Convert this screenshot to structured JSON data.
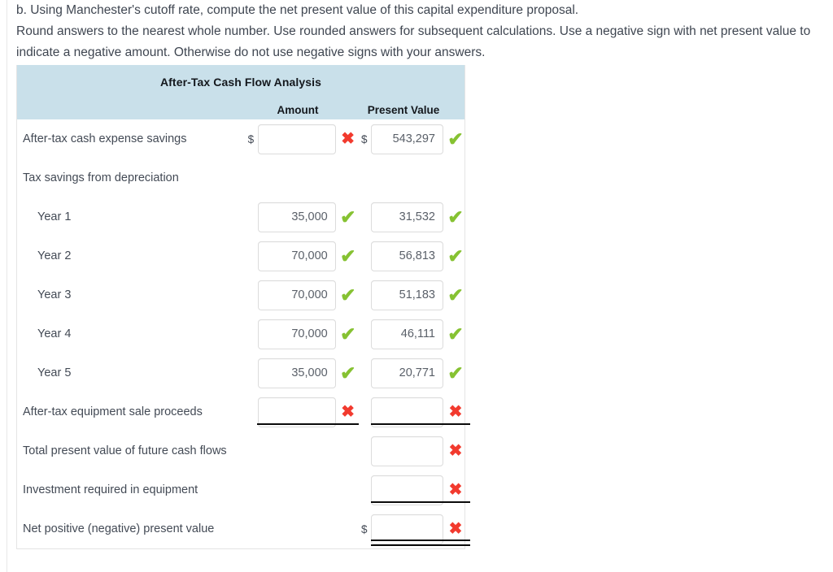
{
  "prompt": {
    "line1": "b. Using Manchester's cutoff rate, compute the net present value of this capital expenditure proposal.",
    "line2": "Round answers to the nearest whole number. Use rounded answers for subsequent calculations. Use a negative sign with net present value to indicate a negative amount. Otherwise do not use negative signs with your answers."
  },
  "table": {
    "title": "After-Tax Cash Flow Analysis",
    "columns": {
      "label": "",
      "amount": "Amount",
      "present_value": "Present Value"
    },
    "currency_symbol": "$",
    "icons": {
      "correct": "check-icon",
      "incorrect": "cross-icon"
    },
    "colors": {
      "header_background": "#c9e0ea",
      "correct": "#86c232",
      "incorrect": "#f23a2e",
      "text": "#434a55",
      "card_border": "#e4e4e4"
    },
    "rows": [
      {
        "label": "After-tax cash expense savings",
        "indent": false,
        "amount": {
          "show": true,
          "dollar": true,
          "value": "",
          "status": "incorrect"
        },
        "present_value": {
          "show": true,
          "dollar": true,
          "value": "543,297",
          "status": "correct"
        },
        "underline": "none"
      },
      {
        "label": "Tax savings from depreciation",
        "indent": false,
        "amount": {
          "show": false,
          "dollar": false,
          "value": "",
          "status": "none"
        },
        "present_value": {
          "show": false,
          "dollar": false,
          "value": "",
          "status": "none"
        },
        "underline": "none"
      },
      {
        "label": "Year 1",
        "indent": true,
        "amount": {
          "show": true,
          "dollar": false,
          "value": "35,000",
          "status": "correct"
        },
        "present_value": {
          "show": true,
          "dollar": false,
          "value": "31,532",
          "status": "correct"
        },
        "underline": "none"
      },
      {
        "label": "Year 2",
        "indent": true,
        "amount": {
          "show": true,
          "dollar": false,
          "value": "70,000",
          "status": "correct"
        },
        "present_value": {
          "show": true,
          "dollar": false,
          "value": "56,813",
          "status": "correct"
        },
        "underline": "none"
      },
      {
        "label": "Year 3",
        "indent": true,
        "amount": {
          "show": true,
          "dollar": false,
          "value": "70,000",
          "status": "correct"
        },
        "present_value": {
          "show": true,
          "dollar": false,
          "value": "51,183",
          "status": "correct"
        },
        "underline": "none"
      },
      {
        "label": "Year 4",
        "indent": true,
        "amount": {
          "show": true,
          "dollar": false,
          "value": "70,000",
          "status": "correct"
        },
        "present_value": {
          "show": true,
          "dollar": false,
          "value": "46,111",
          "status": "correct"
        },
        "underline": "none"
      },
      {
        "label": "Year 5",
        "indent": true,
        "amount": {
          "show": true,
          "dollar": false,
          "value": "35,000",
          "status": "correct"
        },
        "present_value": {
          "show": true,
          "dollar": false,
          "value": "20,771",
          "status": "correct"
        },
        "underline": "none"
      },
      {
        "label": "After-tax equipment sale proceeds",
        "indent": false,
        "amount": {
          "show": true,
          "dollar": false,
          "value": "",
          "status": "incorrect"
        },
        "present_value": {
          "show": true,
          "dollar": false,
          "value": "",
          "status": "incorrect"
        },
        "underline": "single-both"
      },
      {
        "label": "Total present value of future cash flows",
        "indent": false,
        "amount": {
          "show": false,
          "dollar": false,
          "value": "",
          "status": "none"
        },
        "present_value": {
          "show": true,
          "dollar": false,
          "value": "",
          "status": "incorrect"
        },
        "underline": "none"
      },
      {
        "label": "Investment required in equipment",
        "indent": false,
        "amount": {
          "show": false,
          "dollar": false,
          "value": "",
          "status": "none"
        },
        "present_value": {
          "show": true,
          "dollar": false,
          "value": "",
          "status": "incorrect"
        },
        "underline": "single-pv"
      },
      {
        "label": "Net positive (negative) present value",
        "indent": false,
        "amount": {
          "show": false,
          "dollar": false,
          "value": "",
          "status": "none"
        },
        "present_value": {
          "show": true,
          "dollar": true,
          "value": "",
          "status": "incorrect"
        },
        "underline": "double-pv"
      }
    ]
  }
}
